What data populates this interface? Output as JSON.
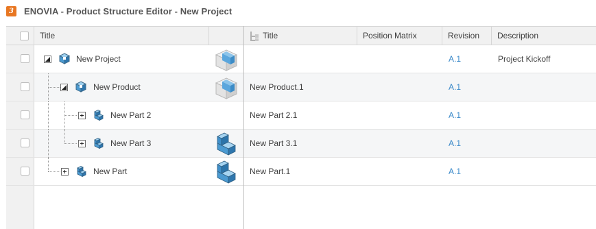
{
  "window": {
    "title": "ENOVIA - Product Structure Editor - New Project"
  },
  "header": {
    "title_label": "Title",
    "right_title_label": "Title",
    "position_matrix_label": "Position Matrix",
    "revision_label": "Revision",
    "description_label": "Description"
  },
  "rows": [
    {
      "title": "New Project",
      "instance": "",
      "revision": "A.1",
      "description": "Project Kickoff"
    },
    {
      "title": "New Product",
      "instance": "New Product.1",
      "revision": "A.1",
      "description": ""
    },
    {
      "title": "New Part 2",
      "instance": "New Part 2.1",
      "revision": "A.1",
      "description": ""
    },
    {
      "title": "New Part 3",
      "instance": "New Part 3.1",
      "revision": "A.1",
      "description": ""
    },
    {
      "title": "New Part",
      "instance": "New Part.1",
      "revision": "A.1",
      "description": ""
    }
  ],
  "colors": {
    "accent": "#e87722",
    "revision_link": "#3a89c9",
    "header_bg": "#f1f1f1"
  }
}
